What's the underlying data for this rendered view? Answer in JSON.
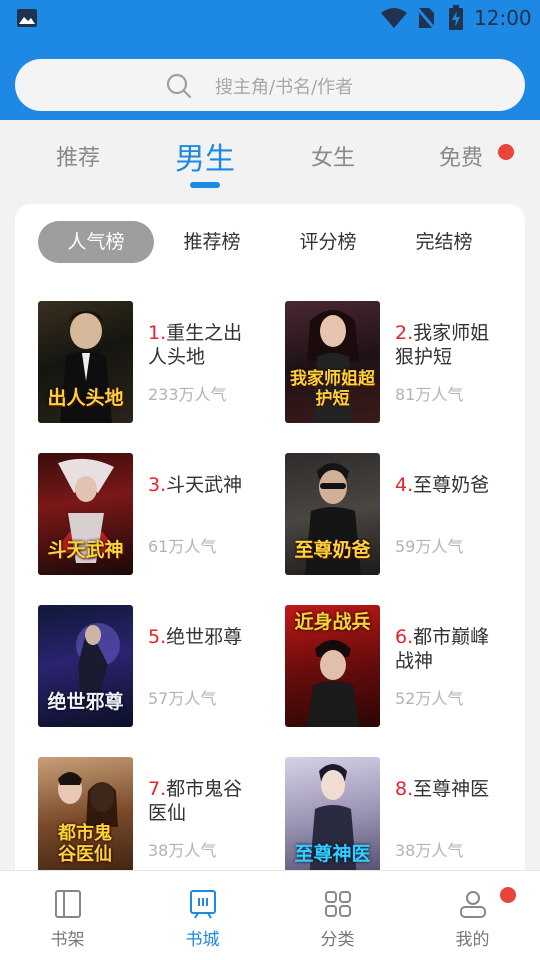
{
  "status_bar": {
    "time": "12:00"
  },
  "search": {
    "placeholder": "搜主角/书名/作者"
  },
  "tabs": [
    {
      "label": "推荐"
    },
    {
      "label": "男生",
      "active": true
    },
    {
      "label": "女生"
    },
    {
      "label": "免费",
      "badge": true
    }
  ],
  "rank_chips": [
    {
      "label": "人气榜",
      "active": true
    },
    {
      "label": "推荐榜"
    },
    {
      "label": "评分榜"
    },
    {
      "label": "完结榜"
    }
  ],
  "books": [
    {
      "rank": "1.",
      "title": "重生之出人头地",
      "popularity": "233万人气",
      "cover_text": "出人头地"
    },
    {
      "rank": "2.",
      "title": "我家师姐狠护短",
      "popularity": "81万人气",
      "cover_text": "我家师姐超护短"
    },
    {
      "rank": "3.",
      "title": "斗天武神",
      "popularity": "61万人气",
      "cover_text": "斗天武神"
    },
    {
      "rank": "4.",
      "title": "至尊奶爸",
      "popularity": "59万人气",
      "cover_text": "至尊奶爸"
    },
    {
      "rank": "5.",
      "title": "绝世邪尊",
      "popularity": "57万人气",
      "cover_text": "绝世邪尊"
    },
    {
      "rank": "6.",
      "title": "都市巅峰战神",
      "popularity": "52万人气",
      "cover_text": "近身战兵"
    },
    {
      "rank": "7.",
      "title": "都市鬼谷医仙",
      "popularity": "38万人气",
      "cover_text": "都市鬼谷医仙"
    },
    {
      "rank": "8.",
      "title": "至尊神医",
      "popularity": "38万人气",
      "cover_text": "至尊神医"
    }
  ],
  "bottom_nav": [
    {
      "label": "书架",
      "icon": "bookshelf-icon"
    },
    {
      "label": "书城",
      "icon": "bookstore-icon",
      "active": true
    },
    {
      "label": "分类",
      "icon": "grid-icon"
    },
    {
      "label": "我的",
      "icon": "user-icon",
      "badge": true
    }
  ],
  "colors": {
    "accent": "#1e88e5",
    "rank": "#e8212b",
    "badge": "#e8453c"
  }
}
